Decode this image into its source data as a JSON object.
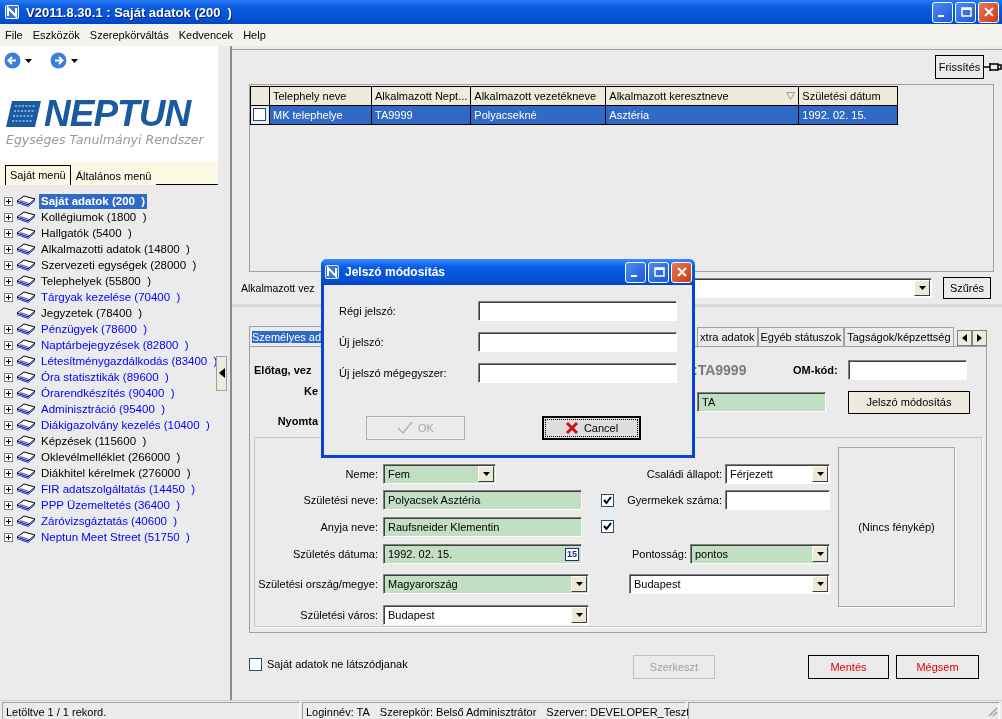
{
  "window": {
    "title": "V2011.8.30.1 : Saját adatok (200  )"
  },
  "menu": [
    {
      "label": "File"
    },
    {
      "label": "Eszközök"
    },
    {
      "label": "Szerepkörváltás"
    },
    {
      "label": "Kedvencek"
    },
    {
      "label": "Help"
    }
  ],
  "logo": {
    "name": "NEPTUN",
    "tagline": "Egységes Tanulmányi Rendszer"
  },
  "sidebar": {
    "tabs": [
      {
        "label": "Saját menü",
        "selected": true
      },
      {
        "label": "Általános menü",
        "selected": false
      }
    ],
    "tree": [
      {
        "label": "Saját adatok (200  )",
        "selected": true,
        "expandable": true
      },
      {
        "label": "Kollégiumok (1800  )",
        "selected": false,
        "expandable": true,
        "color": "#000000"
      },
      {
        "label": "Hallgatók (5400  )",
        "selected": false,
        "expandable": true,
        "color": "#000000"
      },
      {
        "label": "Alkalmazotti adatok (14800  )",
        "selected": false,
        "expandable": true,
        "color": "#000000"
      },
      {
        "label": "Szervezeti egységek (28000  )",
        "selected": false,
        "expandable": true,
        "color": "#000000"
      },
      {
        "label": "Telephelyek (55800  )",
        "selected": false,
        "expandable": true,
        "color": "#000000"
      },
      {
        "label": "Tárgyak kezelése (70400  )",
        "selected": false,
        "expandable": true,
        "color": "#0000ff"
      },
      {
        "label": "Jegyzetek (78400  )",
        "selected": false,
        "expandable": false,
        "color": "#000000"
      },
      {
        "label": "Pénzügyek (78600  )",
        "selected": false,
        "expandable": true,
        "color": "#0000ff"
      },
      {
        "label": "Naptárbejegyzések (82800  )",
        "selected": false,
        "expandable": true,
        "color": "#0000ff"
      },
      {
        "label": "Létesítménygazdálkodás (83400  )",
        "selected": false,
        "expandable": true,
        "color": "#0000ff"
      },
      {
        "label": "Óra statisztikák (89600  )",
        "selected": false,
        "expandable": true,
        "color": "#0000ff"
      },
      {
        "label": "Órarendkészítés (90400  )",
        "selected": false,
        "expandable": true,
        "color": "#0000ff"
      },
      {
        "label": "Adminisztráció (95400  )",
        "selected": false,
        "expandable": true,
        "color": "#0000ff"
      },
      {
        "label": "Diákigazolvány kezelés (10400  )",
        "selected": false,
        "expandable": true,
        "color": "#0000ff"
      },
      {
        "label": "Képzések (115600  )",
        "selected": false,
        "expandable": true,
        "color": "#000000"
      },
      {
        "label": "Oklevélmelléklet (266000  )",
        "selected": false,
        "expandable": true,
        "color": "#000000"
      },
      {
        "label": "Diákhitel kérelmek (276000  )",
        "selected": false,
        "expandable": true,
        "color": "#000000"
      },
      {
        "label": "FIR adatszolgáltatás (14450  )",
        "selected": false,
        "expandable": true,
        "color": "#0000ff"
      },
      {
        "label": "PPP Üzemeltetés (36400  )",
        "selected": false,
        "expandable": true,
        "color": "#0000ff"
      },
      {
        "label": "Záróvizsgáztatás (40600  )",
        "selected": false,
        "expandable": true,
        "color": "#0000ff"
      },
      {
        "label": "Neptun Meet Street (51750  )",
        "selected": false,
        "expandable": true,
        "color": "#0000ff"
      }
    ]
  },
  "toolbar": {
    "refresh_button": "Frissítés"
  },
  "table": {
    "columns": [
      {
        "label": "Telephely neve",
        "sorted": false
      },
      {
        "label": "Alkalmazott Nept...",
        "sorted": false
      },
      {
        "label": "Alkalmazott vezetékneve",
        "sorted": false
      },
      {
        "label": "Alkalmazott keresztneve",
        "sorted": true
      },
      {
        "label": "Születési dátum",
        "sorted": false
      }
    ],
    "rows": [
      {
        "selected": true,
        "checked": false,
        "cells": [
          "MK telephelye",
          "TA9999",
          "Polyacsekné",
          "Asztéria",
          "1992. 02. 15."
        ]
      }
    ]
  },
  "filter": {
    "label": "Alkalmazott vez",
    "button": "Szűrés"
  },
  "tabs": [
    {
      "label": "Személyes ad",
      "selected": true
    },
    {
      "label": "xtra adatok",
      "selected": false
    },
    {
      "label": "Egyéb státuszok",
      "selected": false
    },
    {
      "label": "Tagságok/képzettség",
      "selected": false
    }
  ],
  "header": {
    "prefix_label": "Előtag, vez",
    "code": ":TA9999",
    "om_label": "OM-kód:",
    "second_label": "Ke",
    "second_value": "TA",
    "print_label": "Nyomta",
    "password_button": "Jelszó módosítás"
  },
  "form": {
    "left": [
      {
        "label": "Neme:",
        "kind": "combo",
        "value": "Fem",
        "required": true
      },
      {
        "label": "Születési neve:",
        "kind": "text-check",
        "value": "Polyacsek Asztéria",
        "required": true,
        "checked": true
      },
      {
        "label": "Anyja neve:",
        "kind": "text-check",
        "value": "Raufsneider Klementin",
        "required": true,
        "checked": true
      },
      {
        "label": "Születés dátuma:",
        "kind": "date",
        "value": "1992. 02. 15.",
        "required": true,
        "calendar": "15"
      },
      {
        "label": "Születési ország/megye:",
        "kind": "combo",
        "value": "Magyarország",
        "required": true
      },
      {
        "label": "Születési város:",
        "kind": "combo",
        "value": "Budapest",
        "required": false
      }
    ],
    "right": [
      {
        "label": "Családi állapot:",
        "kind": "combo",
        "value": "Férjezett",
        "required": false
      },
      {
        "label": "Gyermekek száma:",
        "kind": "text",
        "required": false
      },
      {
        "label": "Pontosság:",
        "kind": "combo",
        "value": "pontos",
        "required": true
      },
      {
        "kind": "combo",
        "value": "Budapest",
        "required": false
      }
    ],
    "photo": "(Nincs fénykép)"
  },
  "bottom": {
    "checkbox": {
      "label": "Saját adatok ne látszódjanak",
      "checked": false
    },
    "buttons": [
      {
        "label": "Szerkeszt",
        "disabled": true
      },
      {
        "label": "Mentés",
        "disabled": false
      },
      {
        "label": "Mégsem",
        "disabled": false
      }
    ]
  },
  "status": {
    "record": "Letöltve 1 / 1 rekord.",
    "info": [
      "Loginnév: TA",
      "Szerepkör: Belső Adminisztrátor",
      "Szerver: DEVELOPER_Teszt"
    ]
  },
  "dialog": {
    "title": "Jelszó módosítás",
    "fields": [
      {
        "label": "Régi jelszó:"
      },
      {
        "label": "Új jelszó:"
      },
      {
        "label": "Új jelszó mégegyszer:"
      }
    ],
    "buttons": [
      {
        "label": "OK",
        "disabled": true,
        "focused": false
      },
      {
        "label": "Cancel",
        "disabled": false,
        "focused": true
      }
    ]
  }
}
